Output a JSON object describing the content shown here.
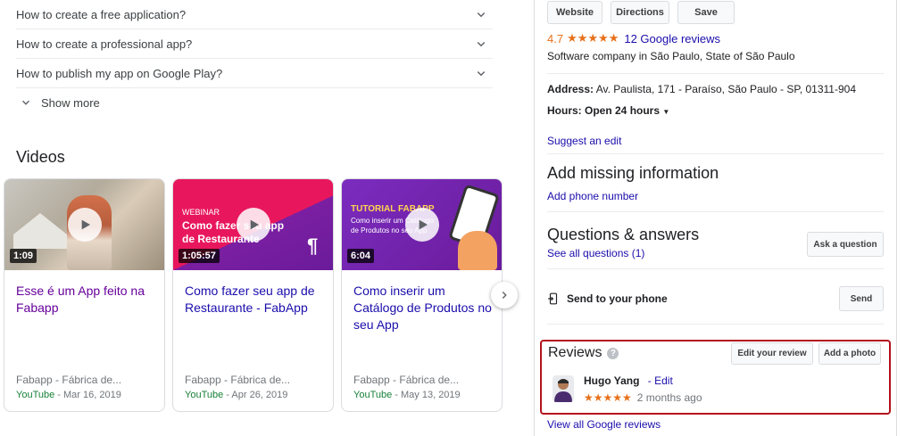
{
  "faq": {
    "items": [
      "How to create a free application?",
      "How to create a professional app?",
      "How to publish my app on Google Play?"
    ],
    "show_more": "Show more"
  },
  "videos": {
    "title": "Videos",
    "cards": [
      {
        "duration": "1:09",
        "title": "Esse é um App feito na Fabapp",
        "channel": "Fabapp - Fábrica de...",
        "source": "YouTube",
        "date": " - Mar 16, 2019",
        "thumb_text": []
      },
      {
        "duration": "1:05:57",
        "title": "Como fazer seu app de Restaurante - FabApp",
        "channel": "Fabapp - Fábrica de...",
        "source": "YouTube",
        "date": " - Apr 26, 2019",
        "thumb_text": [
          "WEBINAR",
          "Como fazer seu app",
          "de Restaurante"
        ]
      },
      {
        "duration": "6:04",
        "title": "Como inserir um Catálogo de Produtos no seu App",
        "channel": "Fabapp - Fábrica de...",
        "source": "YouTube",
        "date": " - May 13, 2019",
        "thumb_text": [
          "TUTORIAL FABAPP",
          "Como inserir um Catálogo",
          "de Produtos no seu App"
        ]
      }
    ]
  },
  "panel": {
    "buttons": {
      "website": "Website",
      "directions": "Directions",
      "save": "Save"
    },
    "rating": "4.7",
    "stars": "★★★★★",
    "reviews_link": "12 Google reviews",
    "category": "Software company in São Paulo, State of São Paulo",
    "address_label": "Address:",
    "address_value": " Av. Paulista, 171 - Paraíso, São Paulo - SP, 01311-904",
    "hours_label": "Hours:",
    "hours_value": " Open 24 hours",
    "suggest_edit": "Suggest an edit",
    "missing_info_heading": "Add missing information",
    "add_phone": "Add phone number",
    "qa_heading": "Questions & answers",
    "see_questions": "See all questions (1)",
    "ask_question": "Ask a question",
    "send_to_phone": "Send to your phone",
    "send": "Send",
    "reviews_heading": "Reviews",
    "edit_review": "Edit your review",
    "add_photo": "Add a photo",
    "review": {
      "author": "Hugo Yang",
      "edit": "- Edit",
      "stars": "★★★★★",
      "time": "2 months ago"
    },
    "view_all_reviews": "View all Google reviews"
  },
  "colors": {
    "link_blue": "#1a0dab",
    "visited_purple": "#660099",
    "star_orange": "#e7711b",
    "highlight_red": "#b3121b",
    "youtube_green": "#188038"
  }
}
